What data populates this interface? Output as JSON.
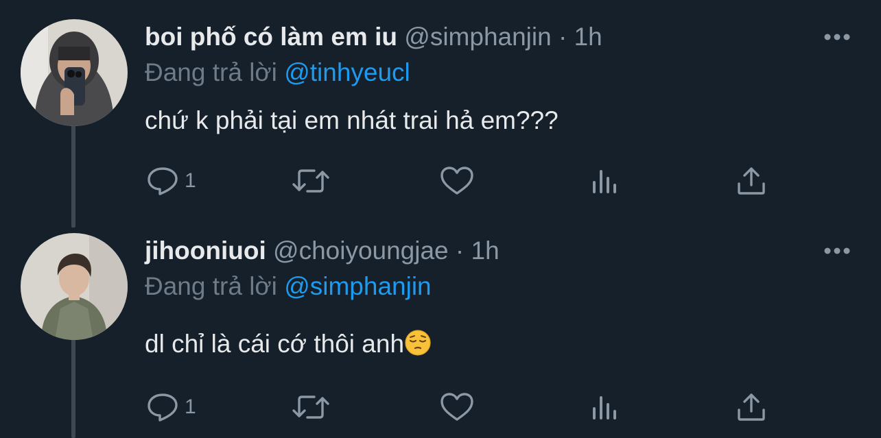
{
  "tweets": [
    {
      "display_name": "boi phố có làm em iu",
      "handle": "@simphanjin",
      "separator": "·",
      "time": "1h",
      "reply_prefix": "Đang trả lời",
      "reply_to": "@tinhyeucl",
      "text": "chứ k phải tại em nhát trai hả em???",
      "reply_count": "1"
    },
    {
      "display_name": "jihooniuoi",
      "handle": "@choiyoungjae",
      "separator": "·",
      "time": "1h",
      "reply_prefix": "Đang trả lời",
      "reply_to": "@simphanjin",
      "text": "dl chỉ là cái cớ thôi anh",
      "text_emoji": "pensive-face-emoji",
      "reply_count": "1"
    }
  ],
  "icons": {
    "more": "more-horizontal-icon",
    "reply": "reply-bubble-icon",
    "retweet": "retweet-icon",
    "like": "heart-icon",
    "views": "bar-chart-icon",
    "share": "share-upload-icon"
  },
  "colors": {
    "background": "#15202b",
    "text": "#e7e9ea",
    "muted": "#8b98a5",
    "link": "#1d9bf0",
    "thread_line": "#3d4853"
  }
}
